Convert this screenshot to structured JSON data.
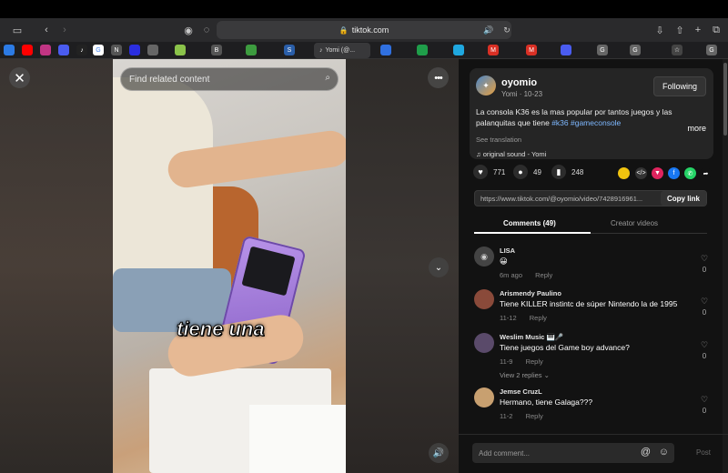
{
  "browser": {
    "url": "tiktok.com",
    "active_tab": "Yomi (@..."
  },
  "tabs": [
    {
      "label": "",
      "color": "#2c7be5"
    },
    {
      "label": "",
      "color": "#ff0000"
    },
    {
      "label": "",
      "color": "#c13584"
    },
    {
      "label": "",
      "color": "#4a5cf0"
    },
    {
      "label": "G",
      "color": "#ffffff"
    },
    {
      "label": "♪",
      "color": "#222222"
    },
    {
      "label": "N",
      "color": "#555555"
    },
    {
      "label": "",
      "color": "#2b2ee0"
    },
    {
      "label": "",
      "color": "#666666"
    },
    {
      "label": "",
      "color": "#8bc34a"
    },
    {
      "label": "B",
      "color": "#555555"
    },
    {
      "label": "",
      "color": "#3d9c3f"
    },
    {
      "label": "S",
      "color": "#2a5ea8"
    },
    {
      "label": "",
      "color": "#3070e0"
    },
    {
      "label": "",
      "color": "#1f9e4a"
    },
    {
      "label": "",
      "color": "#1fa8e0"
    },
    {
      "label": "M",
      "color": "#d93025"
    },
    {
      "label": "M",
      "color": "#d93025"
    },
    {
      "label": "",
      "color": "#4a5cf0"
    },
    {
      "label": "G",
      "color": "#666666"
    },
    {
      "label": "G",
      "color": "#666666"
    },
    {
      "label": "☆",
      "color": "#444444"
    },
    {
      "label": "G",
      "color": "#666666"
    }
  ],
  "video": {
    "search_placeholder": "Find related content",
    "caption": "tiene una"
  },
  "author": {
    "username": "oyomio",
    "display_name": "Yomi",
    "date": "10-23",
    "follow_label": "Following",
    "description_start": "La consola K36 es la mas popular por tantos juegos y las palanquitas que tiene ",
    "tag1": "#k36",
    "tag2": "#gameconsole",
    "more_label": "more",
    "translate_label": "See translation",
    "sound": "original sound - Yomi"
  },
  "stats": {
    "likes": "771",
    "comments": "49",
    "saves": "248"
  },
  "share_icons": [
    {
      "color": "#f1c40f",
      "glyph": ""
    },
    {
      "color": "#333333",
      "glyph": "</>"
    },
    {
      "color": "#e0245e",
      "glyph": "▼"
    },
    {
      "color": "#1877f2",
      "glyph": "f"
    },
    {
      "color": "#25d366",
      "glyph": "✆"
    },
    {
      "color": "#121212",
      "glyph": "➦"
    }
  ],
  "link": {
    "url": "https://www.tiktok.com/@oyomio/video/7428916961...",
    "copy_label": "Copy link"
  },
  "panel_tabs": {
    "comments": "Comments (49)",
    "creator": "Creator videos"
  },
  "comments": [
    {
      "name": "LISA",
      "text": "😀",
      "date": "6m ago",
      "reply": "Reply",
      "likes": "0",
      "avatar": "◉",
      "avatar_color": "#444444"
    },
    {
      "name": "Arismendy Paulino",
      "text": "Tiene KILLER instintc de súper Nintendo la de 1995",
      "date": "11-12",
      "reply": "Reply",
      "likes": "0",
      "avatar": "",
      "avatar_color": "#8a4a3a"
    },
    {
      "name": "Weslim Music 🎹🎤",
      "text": "Tiene juegos del Game boy advance?",
      "date": "11-9",
      "reply": "Reply",
      "likes": "0",
      "avatar": "",
      "avatar_color": "#5a4a6a",
      "view_replies": "View 2 replies"
    },
    {
      "name": "Jemse CruzL",
      "text": "Hermano, tiene Galaga???",
      "date": "11-2",
      "reply": "Reply",
      "likes": "0",
      "avatar": "",
      "avatar_color": "#c8a070"
    }
  ],
  "composer": {
    "placeholder": "Add comment...",
    "post_label": "Post"
  }
}
